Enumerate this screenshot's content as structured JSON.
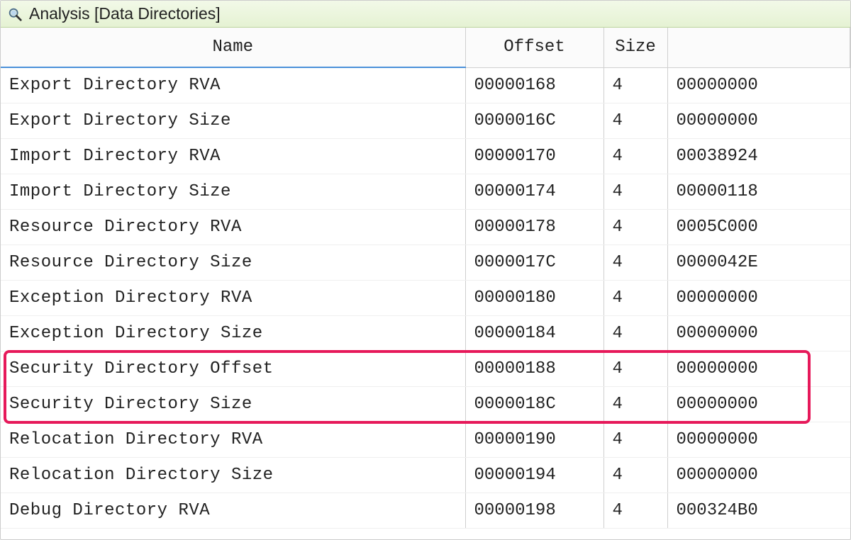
{
  "panel": {
    "title": "Analysis [Data Directories]"
  },
  "columns": {
    "name": "Name",
    "offset": "Offset",
    "size": "Size",
    "value": ""
  },
  "rows": [
    {
      "name": "Export Directory RVA",
      "offset": "00000168",
      "size": "4",
      "value": "00000000"
    },
    {
      "name": "Export Directory Size",
      "offset": "0000016C",
      "size": "4",
      "value": "00000000"
    },
    {
      "name": "Import Directory RVA",
      "offset": "00000170",
      "size": "4",
      "value": "00038924"
    },
    {
      "name": "Import Directory Size",
      "offset": "00000174",
      "size": "4",
      "value": "00000118"
    },
    {
      "name": "Resource Directory RVA",
      "offset": "00000178",
      "size": "4",
      "value": "0005C000"
    },
    {
      "name": "Resource Directory Size",
      "offset": "0000017C",
      "size": "4",
      "value": "0000042E"
    },
    {
      "name": "Exception Directory RVA",
      "offset": "00000180",
      "size": "4",
      "value": "00000000"
    },
    {
      "name": "Exception Directory Size",
      "offset": "00000184",
      "size": "4",
      "value": "00000000"
    },
    {
      "name": "Security Directory Offset",
      "offset": "00000188",
      "size": "4",
      "value": "00000000"
    },
    {
      "name": "Security Directory Size",
      "offset": "0000018C",
      "size": "4",
      "value": "00000000"
    },
    {
      "name": "Relocation Directory RVA",
      "offset": "00000190",
      "size": "4",
      "value": "00000000"
    },
    {
      "name": "Relocation Directory Size",
      "offset": "00000194",
      "size": "4",
      "value": "00000000"
    },
    {
      "name": "Debug Directory RVA",
      "offset": "00000198",
      "size": "4",
      "value": "000324B0"
    }
  ],
  "highlight": {
    "start_row_index": 8,
    "end_row_index": 9
  }
}
